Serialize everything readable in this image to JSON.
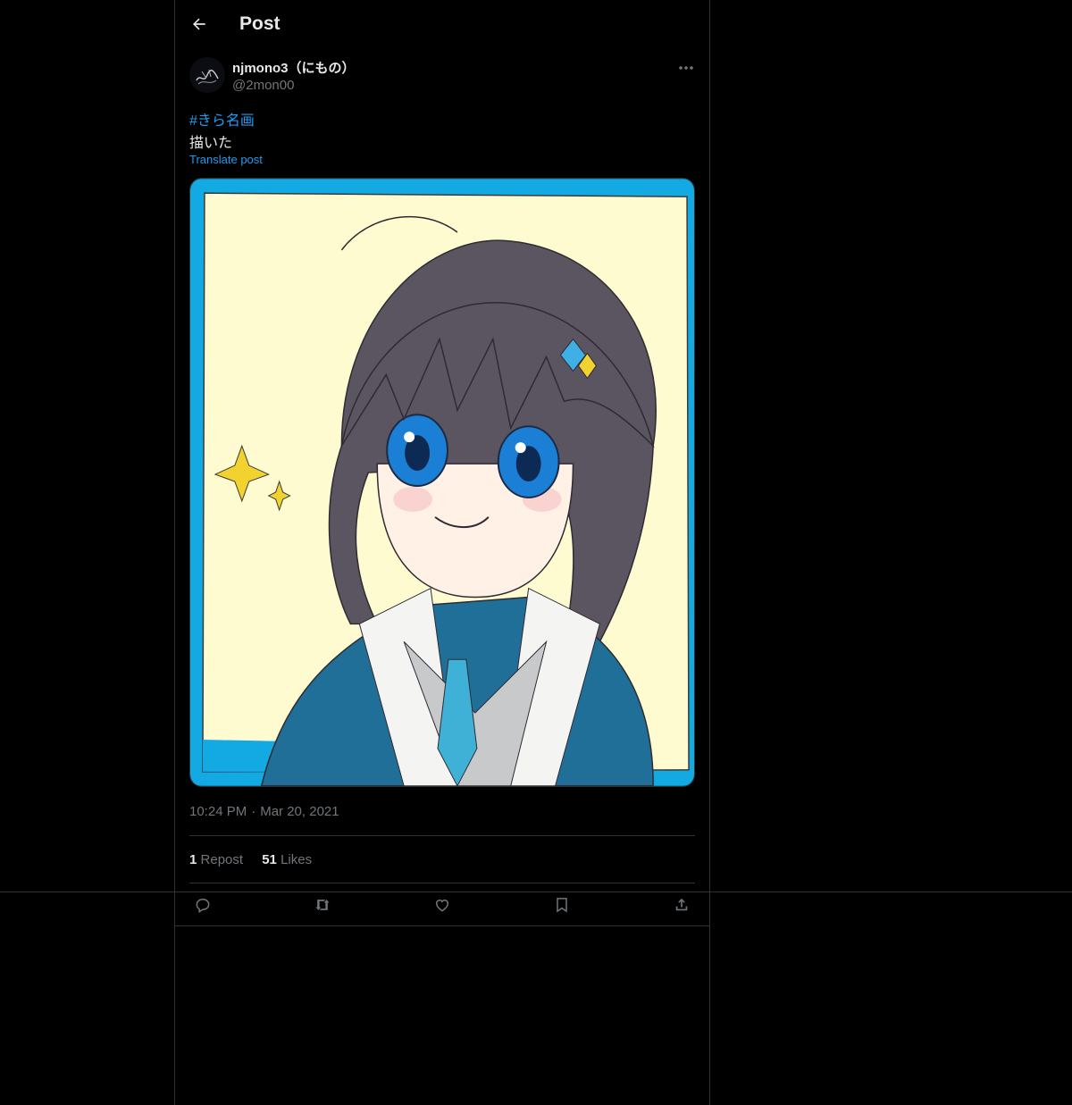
{
  "header": {
    "title": "Post"
  },
  "author": {
    "display_name": "njmono3（にもの）",
    "handle": "@2mon00"
  },
  "post": {
    "hashtag": "#きら名画",
    "text": "描いた",
    "translate_label": "Translate post",
    "time": "10:24 PM",
    "separator": "·",
    "date": "Mar 20, 2021"
  },
  "stats": {
    "reposts_count": "1",
    "reposts_label": "Repost",
    "likes_count": "51",
    "likes_label": "Likes"
  },
  "icons": [
    "back-arrow-icon",
    "more-icon",
    "reply-icon",
    "repost-icon",
    "like-icon",
    "bookmark-icon",
    "share-icon"
  ],
  "colors": {
    "accent": "#1d9bf0",
    "background": "#000000",
    "divider": "#2f3336",
    "secondary_text": "#71767b"
  }
}
